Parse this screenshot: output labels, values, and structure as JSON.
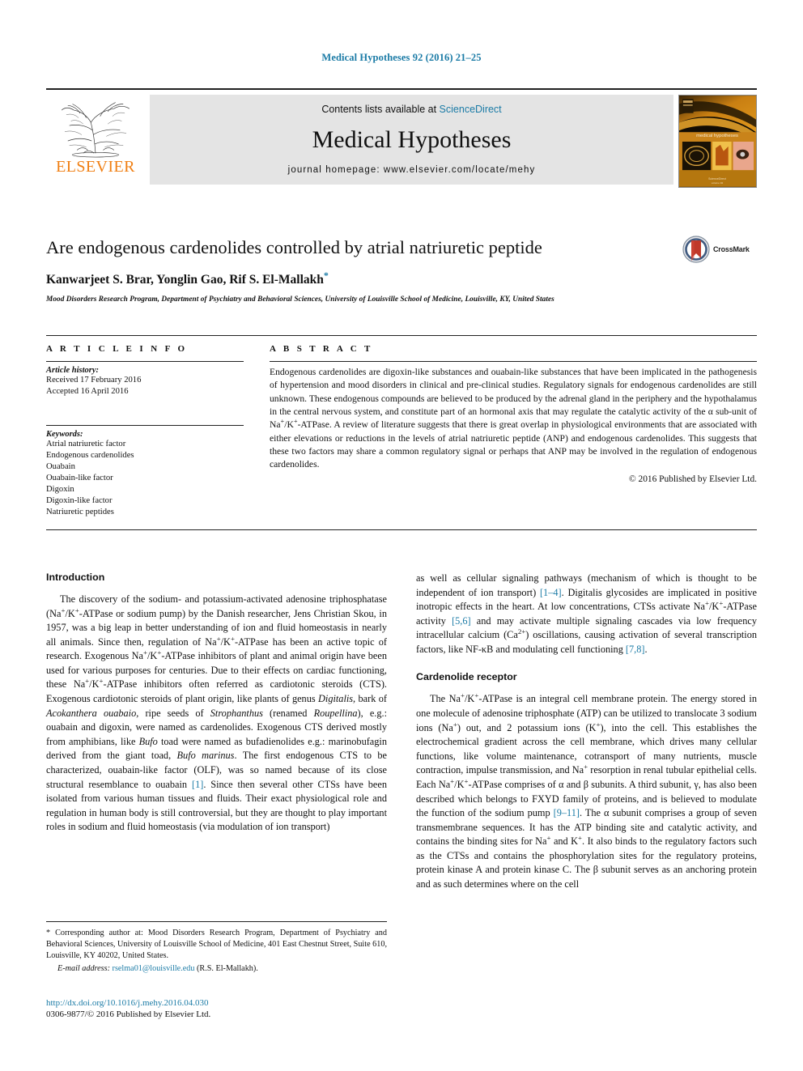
{
  "running_head": "Medical Hypotheses 92 (2016) 21–25",
  "masthead": {
    "contents_prefix": "Contents lists available at ",
    "sciencedirect": "ScienceDirect",
    "journal_title": "Medical Hypotheses",
    "homepage": "journal homepage: www.elsevier.com/locate/mehy",
    "publisher_name": "ELSEVIER",
    "cover_caption": "medical hypotheses"
  },
  "title_block": {
    "title": "Are endogenous cardenolides controlled by atrial natriuretic peptide",
    "authors": "Kanwarjeet S. Brar, Yonglin Gao, Rif S. El-Mallakh",
    "corresponding_marker": "*",
    "affiliation": "Mood Disorders Research Program, Department of Psychiatry and Behavioral Sciences, University of Louisville School of Medicine, Louisville, KY, United States",
    "crossmark_label": "CrossMark"
  },
  "article_info": {
    "heading": "A R T I C L E    I N F O",
    "history_label": "Article history:",
    "history": [
      "Received 17 February 2016",
      "Accepted 16 April 2016"
    ],
    "keywords_label": "Keywords:",
    "keywords": [
      "Atrial natriuretic factor",
      "Endogenous cardenolides",
      "Ouabain",
      "Ouabain-like factor",
      "Digoxin",
      "Digoxin-like factor",
      "Natriuretic peptides"
    ]
  },
  "abstract": {
    "heading": "A B S T R A C T",
    "paragraph_1": "Endogenous cardenolides are digoxin-like substances and ouabain-like substances that have been implicated in the pathogenesis of hypertension and mood disorders in clinical and pre-clinical studies. Regulatory signals for endogenous cardenolides are still unknown. These endogenous compounds are believed to be produced by the adrenal gland in the periphery and the hypothalamus in the central nervous system, and constitute part of an hormonal axis that may regulate the catalytic activity of the α sub-unit of Na",
    "paragraph_2": "-ATPase. A review of literature suggests that there is great overlap in physiological environments that are associated with either elevations or reductions in the levels of atrial natriuretic peptide (ANP) and endogenous cardenolides. This suggests that these two factors may share a common regulatory signal or perhaps that ANP may be involved in the regulation of endogenous cardenolides.",
    "copyright": "© 2016 Published by Elsevier Ltd."
  },
  "body": {
    "left_heading": "Introduction",
    "left_p1_a": "The discovery of the sodium- and potassium-activated adenosine triphosphatase (Na",
    "left_p1_b": "-ATPase or sodium pump) by the Danish researcher, Jens Christian Skou, in 1957, was a big leap in better understanding of ion and fluid homeostasis in nearly all animals. Since then, regulation of Na",
    "left_p1_c": "-ATPase has been an active topic of research. Exogenous Na",
    "left_p1_d": "-ATPase inhibitors of plant and animal origin have been used for various purposes for centuries. Due to their effects on cardiac functioning, these Na",
    "left_p1_e": "-ATPase inhibitors often referred as cardiotonic steroids (CTS). Exogenous cardiotonic steroids of plant origin, like plants of genus ",
    "left_p1_f": "Digitalis, ",
    "left_p1_g": "bark of ",
    "left_p1_h": "Acokanthera ouabaio, ",
    "left_p1_i": "ripe seeds of ",
    "left_p1_j": "Strophanthus ",
    "left_p1_k": "(renamed ",
    "left_p1_l": "Roupellina",
    "left_p1_m": "), e.g.: ouabain and digoxin, were named as cardenolides. Exogenous CTS derived mostly from amphibians, like ",
    "left_p1_n": "Bufo ",
    "left_p1_o": "toad were named as bufadienolides e.g.: marinobufagin derived from the giant toad, ",
    "left_p1_p": "Bufo marinus",
    "left_p1_q": ". The first endogenous CTS to be characterized, ouabain-like factor (OLF), was so named because of its close structural resemblance to ouabain ",
    "left_p1_ref": "[1]",
    "left_p1_r": ". Since then several other CTSs have been isolated from various human tissues and fluids. Their exact physiological role and regulation in human body is still controversial, but they are thought to play important roles in sodium and fluid homeostasis (via modulation of ion transport)",
    "right_p1_a": "as well as cellular signaling pathways (mechanism of which is thought to be independent of ion transport) ",
    "right_p1_ref1": "[1–4]",
    "right_p1_b": ". Digitalis glycosides are implicated in positive inotropic effects in the heart. At low concentrations, CTSs activate Na",
    "right_p1_c": "-ATPase activity ",
    "right_p1_ref2": "[5,6]",
    "right_p1_d": " and may activate multiple signaling cascades via low frequency intracellular calcium (Ca",
    "right_p1_e": ") oscillations, causing activation of several transcription factors, like NF-κB and modulating cell functioning ",
    "right_p1_ref3": "[7,8]",
    "right_p1_f": ".",
    "right_heading": "Cardenolide receptor",
    "right_p2_a": "The Na",
    "right_p2_b": "-ATPase is an integral cell membrane protein. The energy stored in one molecule of adenosine triphosphate (ATP) can be utilized to translocate 3 sodium ions (Na",
    "right_p2_c": ") out, and 2 potassium ions (K",
    "right_p2_d": "), into the cell. This establishes the electrochemical gradient across the cell membrane, which drives many cellular functions, like volume maintenance, cotransport of many nutrients, muscle contraction, impulse transmission, and Na",
    "right_p2_e": " resorption in renal tubular epithelial cells. Each Na",
    "right_p2_f": "-ATPase comprises of α and β subunits. A third subunit, γ, has also been described which belongs to FXYD family of proteins, and is believed to modulate the function of the sodium pump ",
    "right_p2_ref": "[9–11]",
    "right_p2_g": ". The α subunit comprises a group of seven transmembrane sequences. It has the ATP binding site and catalytic activity, and contains the binding sites for Na",
    "right_p2_h": " and K",
    "right_p2_i": ". It also binds to the regulatory factors such as the CTSs and contains the phosphorylation sites for the regulatory proteins, protein kinase A and protein kinase C. The β subunit serves as an anchoring protein and as such determines where on the cell"
  },
  "footnote": {
    "marker": "*",
    "text": " Corresponding author at: Mood Disorders Research Program, Department of Psychiatry and Behavioral Sciences, University of Louisville School of Medicine, 401 East Chestnut Street, Suite 610, Louisville, KY 40202, United States.",
    "email_label": "E-mail address:",
    "email": "rselma01@louisville.edu",
    "email_owner": "(R.S. El-Mallakh)."
  },
  "doi": {
    "url": "http://dx.doi.org/10.1016/j.mehy.2016.04.030",
    "issn_line": "0306-9877/© 2016 Published by Elsevier Ltd."
  },
  "colors": {
    "link": "#1b7ba6",
    "elsevier_orange": "#f07f13",
    "masthead_bg": "#e4e4e4"
  }
}
